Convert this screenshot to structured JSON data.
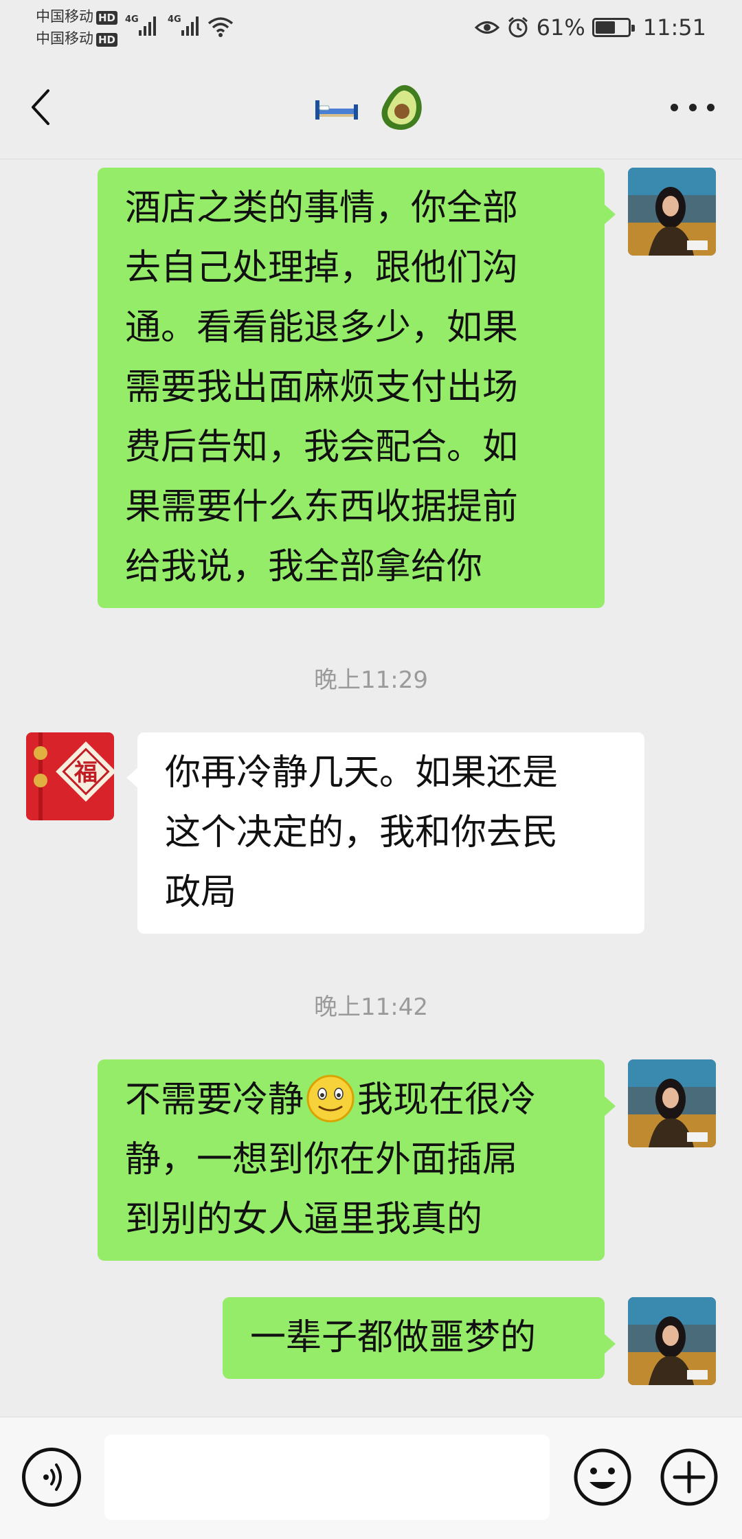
{
  "status_bar": {
    "carrier1": "中国移动",
    "carrier2": "中国移动",
    "hd_badge": "HD",
    "network1": "4G",
    "network2": "4G",
    "battery_percent": "61%",
    "battery_level": 0.61,
    "time": "11:51"
  },
  "nav": {
    "title_icons": [
      "bed-emoji-icon",
      "avocado-emoji-icon"
    ]
  },
  "messages": [
    {
      "sender": "me",
      "lines": [
        "酒店之类的事情，你全部",
        "去自己处理掉，跟他们沟",
        "通。看看能退多少，如果",
        "需要我出面麻烦支付出场",
        "费后告知，我会配合。如",
        "果需要什么东西收据提前",
        "给我说，我全部拿给你"
      ]
    },
    {
      "timestamp": "晚上11:29"
    },
    {
      "sender": "them",
      "lines": [
        "你再冷静几天。如果还是",
        "这个决定的，我和你去民",
        "政局"
      ]
    },
    {
      "timestamp": "晚上11:42"
    },
    {
      "sender": "me",
      "line1_before": "不需要冷静",
      "line1_after": "我现在很冷",
      "line2": "静，一想到你在外面插屌",
      "line3": "到别的女人逼里我真的"
    },
    {
      "sender": "me",
      "lines": [
        "一辈子都做噩梦的"
      ]
    }
  ],
  "colors": {
    "background": "#ededed",
    "my_bubble": "#95ec69",
    "their_bubble": "#ffffff"
  },
  "input_bar": {
    "text_value": ""
  }
}
